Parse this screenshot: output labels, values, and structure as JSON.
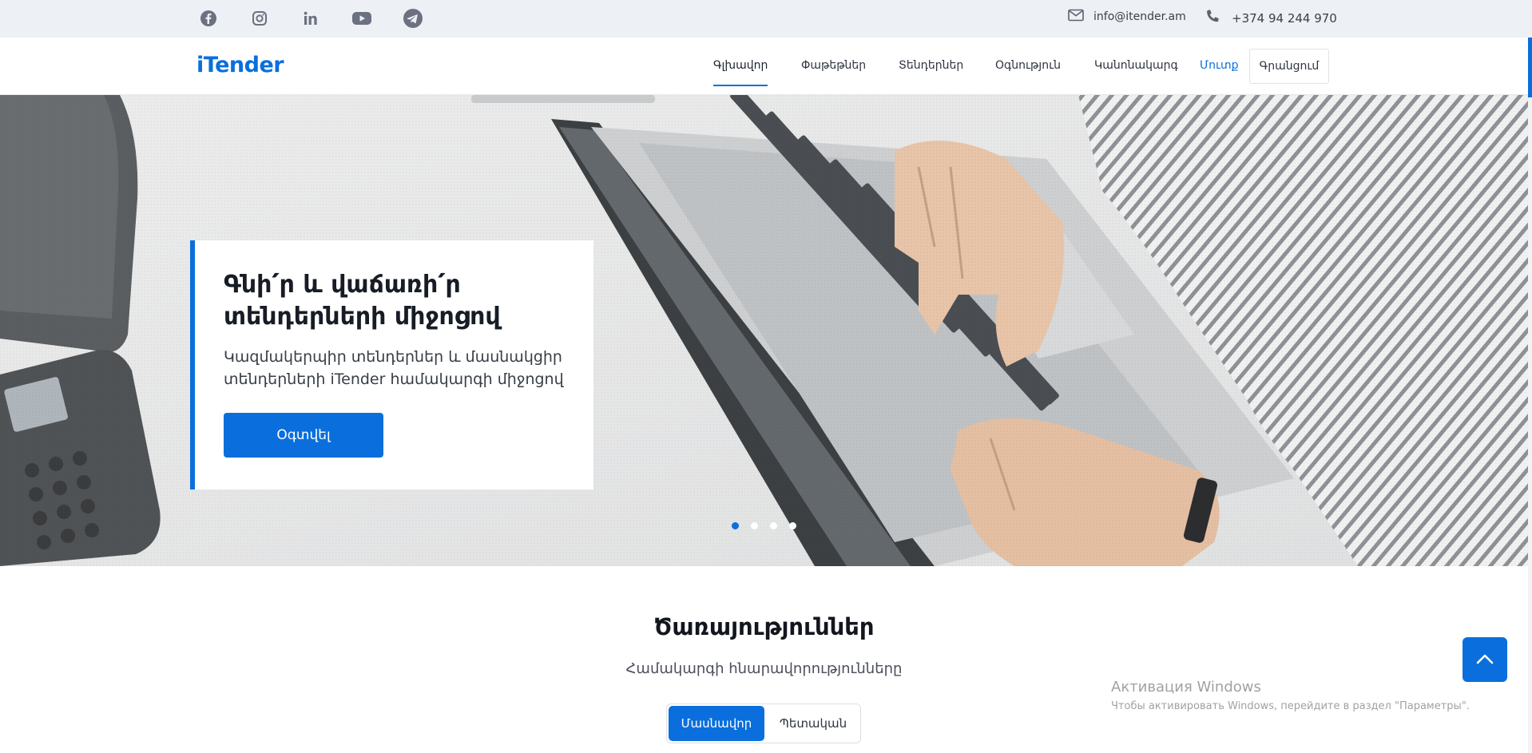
{
  "topbar": {
    "social": [
      {
        "icon": "facebook-icon"
      },
      {
        "icon": "instagram-icon"
      },
      {
        "icon": "linkedin-icon"
      },
      {
        "icon": "youtube-icon"
      },
      {
        "icon": "telegram-icon"
      }
    ],
    "email": "info@itender.am",
    "phone": "+374 94 244 970"
  },
  "navbar": {
    "logo": "iTender",
    "items": [
      {
        "label": "Գլխավոր",
        "active": true
      },
      {
        "label": "Փաթեթներ",
        "active": false
      },
      {
        "label": "Տենդերներ",
        "active": false
      },
      {
        "label": "Օգնություն",
        "active": false
      },
      {
        "label": "Կանոնակարգ",
        "active": false
      }
    ],
    "login": "Մուտք",
    "register": "Գրանցում"
  },
  "hero": {
    "title": "Գնի՛ր և վաճառի՛ր տենդերների միջոցով",
    "subtitle": "Կազմակերպիր տենդերներ և մասնակցիր տենդերների iTender համակարգի միջոցով",
    "button": "Օգտվել",
    "slides_total": 4,
    "active_slide": 1
  },
  "services": {
    "title": "Ծառայություններ",
    "subtitle": "Համակարգի հնարավորությունները",
    "tabs": [
      "Մասնավոր",
      "Պետական"
    ],
    "active_tab": 0
  },
  "watermark": {
    "title": "Активация Windows",
    "subtitle": "Чтобы активировать Windows, перейдите в раздел \"Параметры\"."
  },
  "colors": {
    "accent": "#0a6fdc",
    "topbar_bg": "#edf0f4"
  }
}
